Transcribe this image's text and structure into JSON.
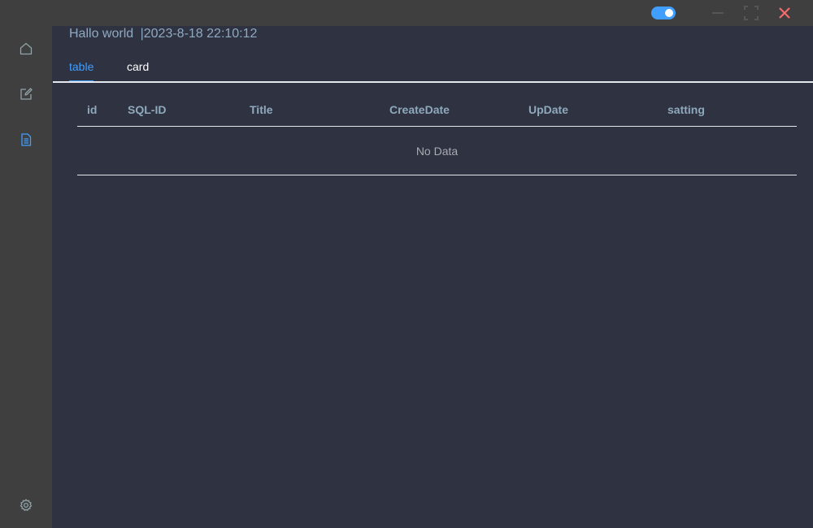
{
  "titlebar": {
    "theme_toggle": {
      "on": true,
      "color": "#409eff"
    },
    "minimize_icon": "minimize-icon",
    "maximize_icon": "maximize-icon",
    "close_icon": "close-icon",
    "close_color": "#f56c6c"
  },
  "sidebar": {
    "items": [
      {
        "icon": "home-icon"
      },
      {
        "icon": "edit-icon"
      },
      {
        "icon": "document-icon",
        "active": true
      }
    ],
    "footer_icon": "gear-icon"
  },
  "header": {
    "greeting": "Hallo world",
    "separator": "|",
    "datetime": "2023-8-18 22:10:12"
  },
  "tabs": [
    {
      "label": "table",
      "active": true
    },
    {
      "label": "card",
      "active": false
    }
  ],
  "table": {
    "columns": [
      "id",
      "SQL-ID",
      "Title",
      "CreateDate",
      "UpDate",
      "satting"
    ],
    "rows": [],
    "empty_text": "No Data"
  },
  "colors": {
    "accent": "#409eff",
    "background": "#2f3240",
    "chrome": "#3f3f3f",
    "header_text": "#8fa9c2"
  }
}
